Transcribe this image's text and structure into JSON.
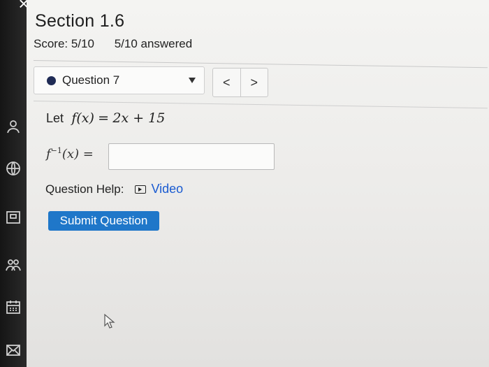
{
  "rail": {
    "icons": [
      "user-icon",
      "globe-icon",
      "gradebook-icon",
      "people-icon",
      "calendar-icon",
      "mail-icon"
    ]
  },
  "close_glyph": "×",
  "header": {
    "title": "Section 1.6",
    "score": "Score: 5/10",
    "answered": "5/10 answered"
  },
  "question_nav": {
    "selected": "Question 7",
    "prev": "<",
    "next": ">"
  },
  "question": {
    "let_word": "Let",
    "function_lhs": "f(x)",
    "equals": "=",
    "function_rhs": "2x + 15",
    "inverse_base": "f",
    "inverse_exponent": "−1",
    "inverse_arg": "(x) =",
    "answer_value": ""
  },
  "help": {
    "label": "Question Help:",
    "video_label": "Video"
  },
  "submit_label": "Submit Question",
  "colors": {
    "accent": "#1f77c9",
    "link": "#1a5bd1",
    "dot": "#1f2b55"
  }
}
